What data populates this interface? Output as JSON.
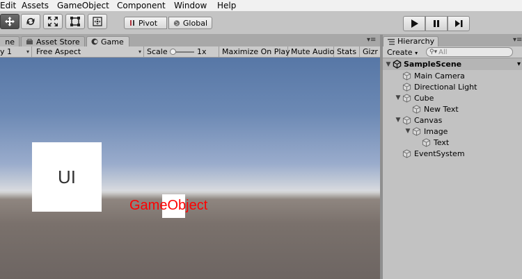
{
  "menu": [
    "Edit",
    "Assets",
    "GameObject",
    "Component",
    "Window",
    "Help"
  ],
  "toolbar": {
    "pivot_label": "Pivot",
    "global_label": "Global",
    "play_icon": "play-icon",
    "pause_icon": "pause-icon",
    "step_icon": "step-icon"
  },
  "tabs": {
    "scene_partial": "ne",
    "asset_store": "Asset Store",
    "game": "Game"
  },
  "game_toolbar": {
    "display": "y 1",
    "aspect": "Free Aspect",
    "scale_label": "Scale",
    "scale_value": "1x",
    "maximize": "Maximize On Play",
    "mute": "Mute Audio",
    "stats": "Stats",
    "gizmos": "Gizr"
  },
  "game_view": {
    "ui_panel_text": "UI",
    "gameobject_label": "GameObject",
    "label_color": "#ff0000"
  },
  "hierarchy": {
    "tab_label": "Hierarchy",
    "create_label": "Create",
    "search_placeholder": "All",
    "scene_name": "SampleScene",
    "items": [
      {
        "label": "Main Camera",
        "depth": 0,
        "expanded": null
      },
      {
        "label": "Directional Light",
        "depth": 0,
        "expanded": null
      },
      {
        "label": "Cube",
        "depth": 0,
        "expanded": true
      },
      {
        "label": "New Text",
        "depth": 1,
        "expanded": null
      },
      {
        "label": "Canvas",
        "depth": 0,
        "expanded": true
      },
      {
        "label": "Image",
        "depth": 1,
        "expanded": true
      },
      {
        "label": "Text",
        "depth": 2,
        "expanded": null
      },
      {
        "label": "EventSystem",
        "depth": 0,
        "expanded": null
      }
    ]
  }
}
